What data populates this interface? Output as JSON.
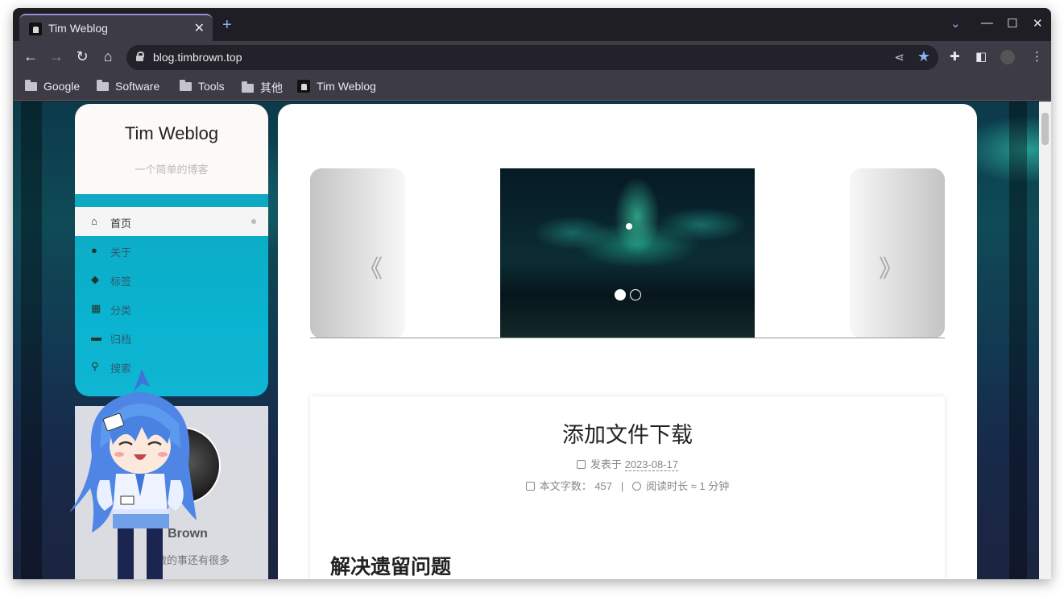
{
  "browser": {
    "tab_title": "Tim Weblog",
    "tab_close": "✕",
    "new_tab": "+",
    "url": "blog.timbrown.top",
    "bookmarks": [
      "Google",
      "Software",
      "Tools",
      "其他",
      "Tim Weblog"
    ]
  },
  "blog": {
    "site_name": "Tim Weblog",
    "subtitle": "一个简单的博客",
    "menu": [
      {
        "label": "首页",
        "icon": "home-icon",
        "active": true
      },
      {
        "label": "关于",
        "icon": "user-icon"
      },
      {
        "label": "标签",
        "icon": "tags-icon"
      },
      {
        "label": "分类",
        "icon": "grid-icon"
      },
      {
        "label": "归档",
        "icon": "archive-icon"
      },
      {
        "label": "搜索",
        "icon": "search-icon"
      }
    ],
    "author_name": "Brown",
    "author_motto": "要做的事还有很多"
  },
  "carousel": {
    "prev": "《",
    "next": "》",
    "slide_count": 2,
    "active_slide": 1
  },
  "post": {
    "title": "添加文件下载",
    "posted_label": "发表于",
    "date": "2023-08-17",
    "words_label": "本文字数：",
    "words": "457",
    "separator": "|",
    "reading_time": "阅读时长 ≈ 1 分钟",
    "heading": "解决遗留问题"
  },
  "colors": {
    "menu_bg": "#0ab3cf",
    "accent": "#8ab4f8"
  }
}
